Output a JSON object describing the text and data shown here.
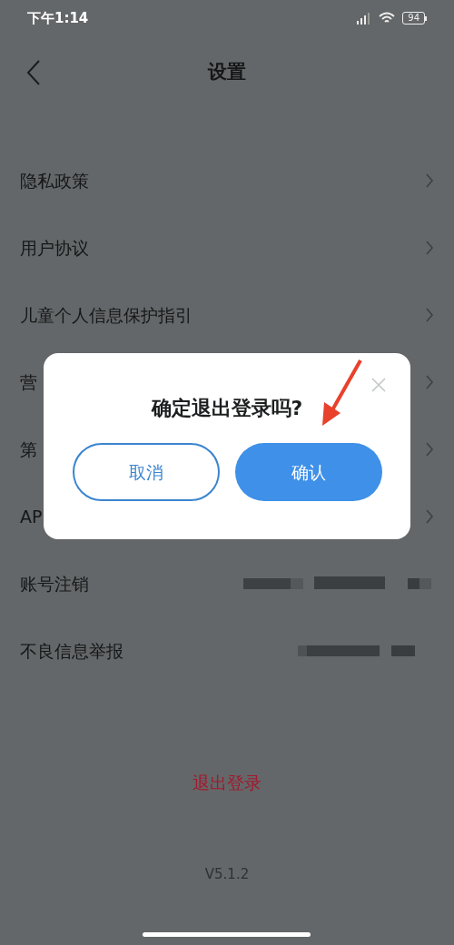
{
  "status_bar": {
    "time": "下午1:14",
    "battery": "94"
  },
  "header": {
    "title": "设置"
  },
  "rows": [
    {
      "label": "隐私政策",
      "kind": "link"
    },
    {
      "label": "用户协议",
      "kind": "link"
    },
    {
      "label": "儿童个人信息保护指引",
      "kind": "link"
    },
    {
      "label": "营",
      "kind": "link"
    },
    {
      "label": "第",
      "kind": "link"
    },
    {
      "label": "AP",
      "kind": "link"
    },
    {
      "label": "账号注销",
      "kind": "redacted"
    },
    {
      "label": "不良信息举报",
      "kind": "redacted"
    }
  ],
  "logout": {
    "label": "退出登录"
  },
  "version": "V5.1.2",
  "dialog": {
    "title": "确定退出登录吗?",
    "cancel": "取消",
    "confirm": "确认"
  }
}
